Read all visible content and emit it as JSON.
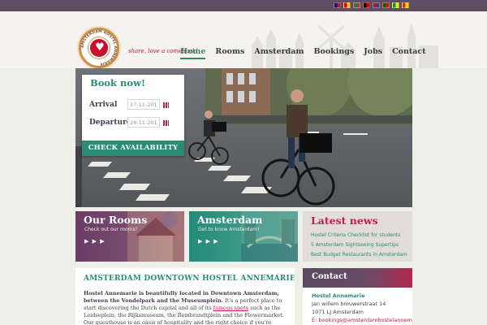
{
  "languages": [
    {
      "code": "en",
      "color_a": "#012169",
      "color_b": "#c8102e"
    },
    {
      "code": "es",
      "color_a": "#c60b1e",
      "color_b": "#ffc400"
    },
    {
      "code": "it",
      "color_a": "#009246",
      "color_b": "#ce2b37"
    },
    {
      "code": "de",
      "color_a": "#000000",
      "color_b": "#dd0000"
    },
    {
      "code": "nl",
      "color_a": "#ae1c28",
      "color_b": "#21468b"
    },
    {
      "code": "pt",
      "color_a": "#006600",
      "color_b": "#ff0000"
    },
    {
      "code": "br",
      "color_a": "#009c3b",
      "color_b": "#ffdf00"
    },
    {
      "code": "cn",
      "color_a": "#de2910",
      "color_b": "#ffde00"
    }
  ],
  "brand": {
    "name": "AMSTERDAM HOSTEL ANNEMARIE",
    "slogan": "share, love a comeback!",
    "colors": {
      "teal": "#2a8c73",
      "plum": "#5e4d63",
      "crimson": "#c21d4b"
    }
  },
  "nav": {
    "items": [
      {
        "label": "Home",
        "active": true
      },
      {
        "label": "Rooms",
        "active": false
      },
      {
        "label": "Amsterdam",
        "active": false
      },
      {
        "label": "Bookings",
        "active": false
      },
      {
        "label": "Jobs",
        "active": false
      },
      {
        "label": "Contact",
        "active": false
      }
    ]
  },
  "booking": {
    "title": "Book now!",
    "arrival_label": "Arrival",
    "arrival_value": "27-11-201",
    "departure_label": "Departure",
    "departure_value": "28-11-201",
    "button": "CHECK AVAILABILITY"
  },
  "tiles": {
    "rooms": {
      "title": "Our Rooms",
      "subtitle": "Check out our rooms!",
      "arrows": "▶ ▶ ▶"
    },
    "amsterdam": {
      "title": "Amsterdam",
      "subtitle": "Get to know Amsterdam!",
      "arrows": "▶ ▶ ▶"
    }
  },
  "news": {
    "title": "Latest news",
    "items": [
      "Hostel Criteria Checklist for students",
      "5 Amsterdam Sightseeing Supertips",
      "Best Budget Restaurants in Amsterdam"
    ]
  },
  "content": {
    "title": "AMSTERDAM DOWNTOWN HOSTEL ANNEMARIE",
    "intro_bold": "Hostel Annemarie is beautifully located in Downtown Amsterdam, between the Vondelpark and the Museumplein.",
    "text_1": " It's a perfect place to start discovering the Dutch capital and all of its ",
    "link": "famous spots",
    "text_2": " such as the Leidseplein, the Rijksmuseum, the Rembrandtplein and the Flowermarket. Our guesthouse is an oasis of hospitality and the right choice if you're looking for the ideal mix between"
  },
  "contact": {
    "title": "Contact",
    "name": "Hostel Annemarie",
    "street": "Jan willem brouwerstraat 14",
    "city": "1071 LJ Amsterdam",
    "email_label": "E:",
    "email": "bookings@amsterdamhostelannemarie.nl"
  }
}
